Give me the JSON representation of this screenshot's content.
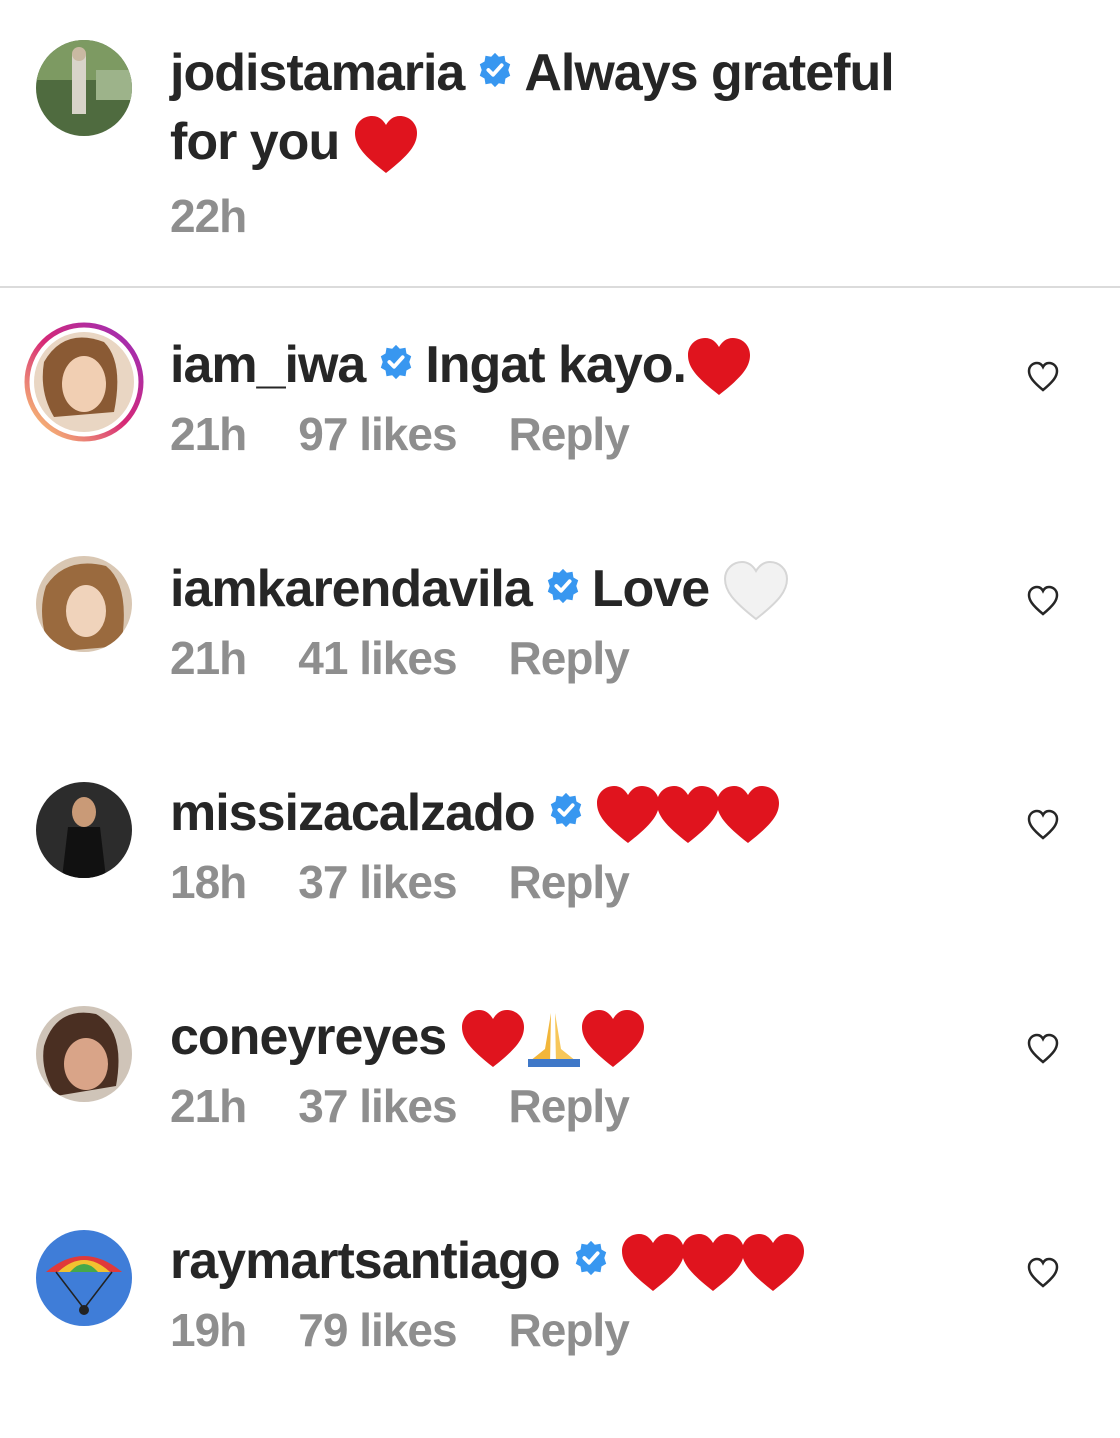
{
  "caption": {
    "username": "jodistamaria",
    "text_line1": "Always grateful",
    "text_line2": "for you",
    "time": "22h"
  },
  "comments": [
    {
      "username": "iam_iwa",
      "text": "Ingat kayo.",
      "time": "21h",
      "likes": "97 likes",
      "reply": "Reply"
    },
    {
      "username": "iamkarendavila",
      "text": "Love",
      "time": "21h",
      "likes": "41 likes",
      "reply": "Reply"
    },
    {
      "username": "missizacalzado",
      "text": "",
      "time": "18h",
      "likes": "37 likes",
      "reply": "Reply"
    },
    {
      "username": "coneyreyes",
      "text": "",
      "time": "21h",
      "likes": "37 likes",
      "reply": "Reply"
    },
    {
      "username": "raymartsantiago",
      "text": "",
      "time": "19h",
      "likes": "79 likes",
      "reply": "Reply"
    }
  ],
  "icons": {
    "verified": "verified-badge-icon",
    "like": "heart-outline-icon",
    "red_heart": "red-heart-emoji",
    "white_heart": "white-heart-emoji",
    "pray": "folded-hands-emoji"
  },
  "colors": {
    "verified": "#3897f0",
    "meta_text": "#8e8e8e",
    "heart_red": "#e0141e",
    "divider": "#dbdbdb",
    "story_ring": "#c13584"
  }
}
